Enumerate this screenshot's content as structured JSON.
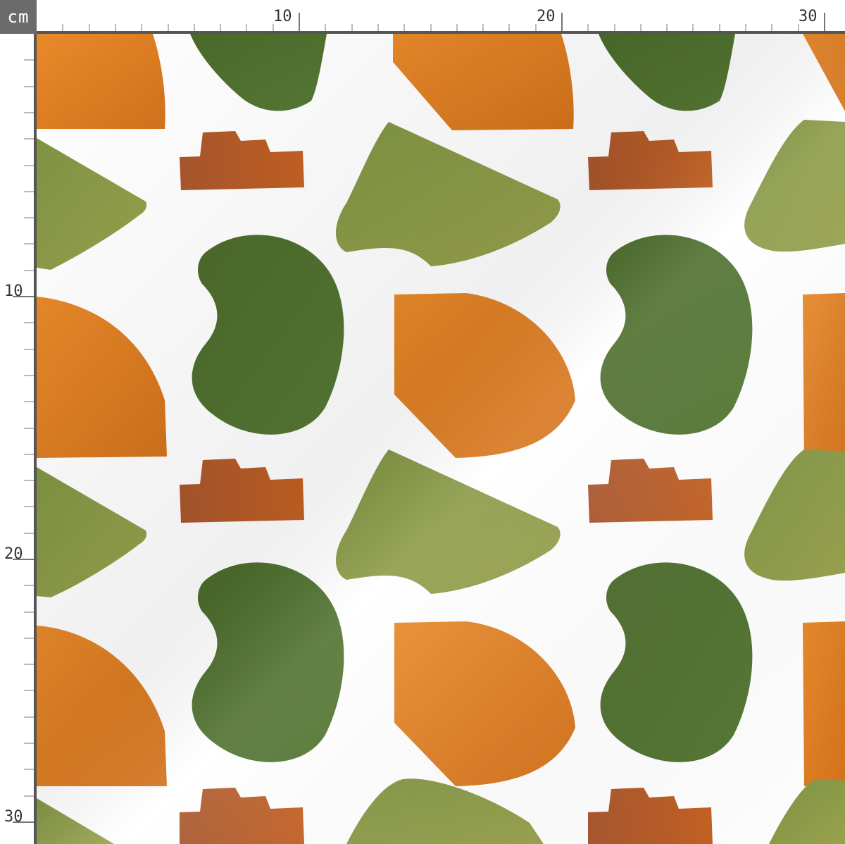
{
  "ruler": {
    "unit": "cm",
    "top_labels": [
      "10",
      "20",
      "30"
    ],
    "left_labels": [
      "10",
      "20",
      "30"
    ]
  },
  "fabric": {
    "pattern": "watercolor abstract shapes",
    "colors": {
      "orange": "#e07f22",
      "rust": "#b2582a",
      "dark_green": "#4f7030",
      "olive": "#8a994a",
      "background": "#ffffff",
      "ruler_bar": "#555555"
    }
  }
}
